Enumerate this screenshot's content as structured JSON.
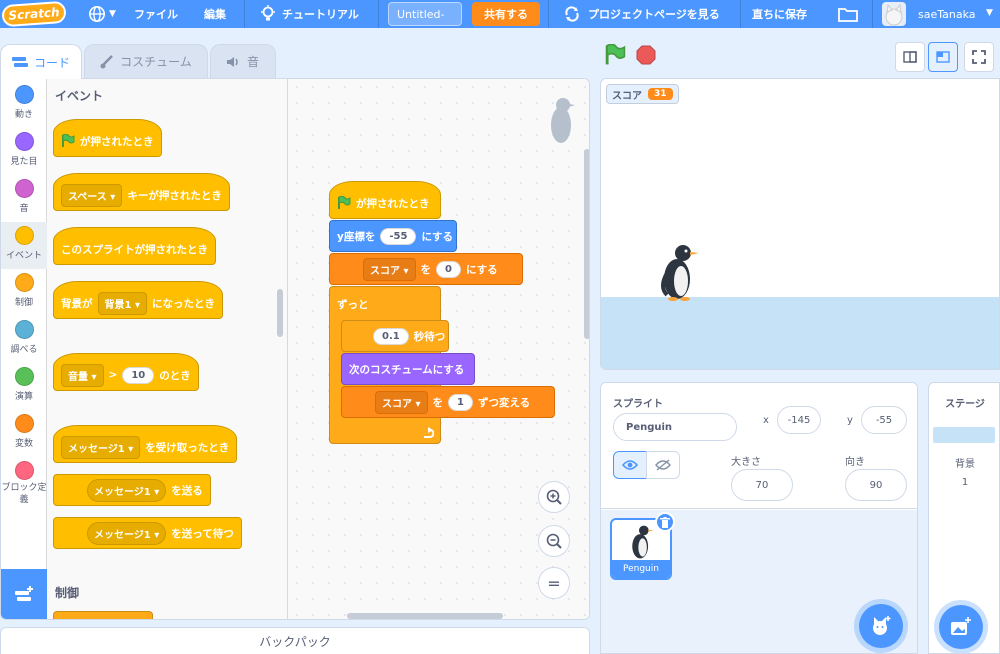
{
  "menubar": {
    "logo": "Scratch",
    "file": "ファイル",
    "edit": "編集",
    "tutorials": "チュートリアル",
    "project_title": "Untitled-",
    "share": "共有する",
    "see_project_page": "プロジェクトページを見る",
    "save_now": "直ちに保存",
    "username": "saeTanaka"
  },
  "tabs": {
    "code": "コード",
    "costumes": "コスチューム",
    "sounds": "音"
  },
  "categories": [
    {
      "label": "動き",
      "color": "#4c97ff"
    },
    {
      "label": "見た目",
      "color": "#9966ff"
    },
    {
      "label": "音",
      "color": "#cf63cf"
    },
    {
      "label": "イベント",
      "color": "#ffbf00"
    },
    {
      "label": "制御",
      "color": "#ffab19"
    },
    {
      "label": "調べる",
      "color": "#5cb1d6"
    },
    {
      "label": "演算",
      "color": "#59c059"
    },
    {
      "label": "変数",
      "color": "#ff8c1a"
    },
    {
      "label": "ブロック定義",
      "color": "#ff6680"
    }
  ],
  "palette": {
    "events_heading": "イベント",
    "flag_clicked": "が押されたとき",
    "key_dropdown": "スペース",
    "key_pressed": "キーが押されたとき",
    "sprite_clicked": "このスプライトが押されたとき",
    "backdrop_prefix": "背景が",
    "backdrop_dropdown": "背景1",
    "backdrop_suffix": "になったとき",
    "loudness_dropdown": "音量",
    "greater_than": ">",
    "loudness_value": "10",
    "loudness_suffix": "のとき",
    "message_dropdown": "メッセージ1",
    "receive_suffix": "を受け取ったとき",
    "broadcast_suffix": "を送る",
    "broadcast_wait_suffix": "を送って待つ",
    "control_heading": "制御"
  },
  "script": {
    "flag_clicked": "が押されたとき",
    "set_y_prefix": "y座標を",
    "set_y_value": "-55",
    "set_y_suffix": "にする",
    "var_dropdown": "スコア",
    "set_var_mid": "を",
    "set_var_value": "0",
    "set_var_suffix": "にする",
    "forever": "ずっと",
    "wait_value": "0.1",
    "wait_suffix": "秒待つ",
    "next_costume": "次のコスチュームにする",
    "change_var_mid": "を",
    "change_var_value": "1",
    "change_var_suffix": "ずつ変える"
  },
  "zoom": {
    "reset_symbol": "="
  },
  "backpack": "バックパック",
  "stage": {
    "monitor_label": "スコア",
    "monitor_value": "31"
  },
  "sprite_info": {
    "sprite_label": "スプライト",
    "sprite_name": "Penguin",
    "x_label": "x",
    "x_value": "-145",
    "y_label": "y",
    "y_value": "-55",
    "size_label": "大きさ",
    "size_value": "70",
    "direction_label": "向き",
    "direction_value": "90"
  },
  "sprite_list": [
    {
      "name": "Penguin"
    }
  ],
  "stage_pane": {
    "title": "ステージ",
    "backdrops_label": "背景",
    "backdrops_count": "1"
  }
}
